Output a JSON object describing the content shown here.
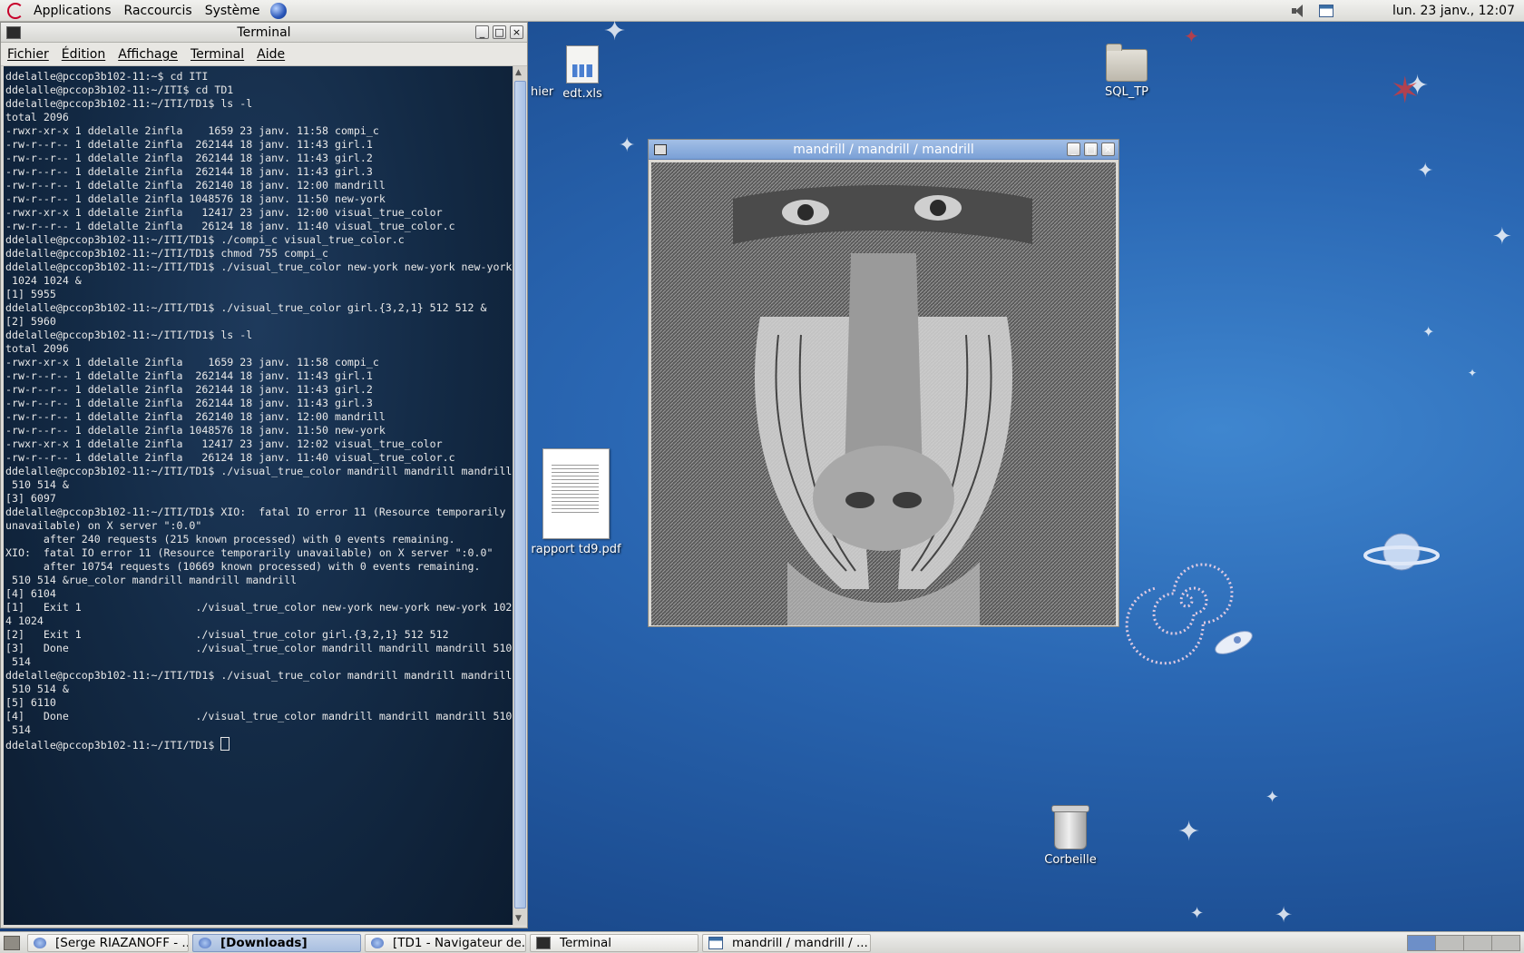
{
  "top_panel": {
    "menus": [
      "Applications",
      "Raccourcis",
      "Système"
    ],
    "clock": "lun. 23 janv., 12:07",
    "tray_icons": [
      "volume-icon",
      "window-list-icon"
    ]
  },
  "terminal": {
    "title": "Terminal",
    "menu": [
      "Fichier",
      "Édition",
      "Affichage",
      "Terminal",
      "Aide"
    ],
    "lines": [
      "ddelalle@pccop3b102-11:~$ cd ITI",
      "ddelalle@pccop3b102-11:~/ITI$ cd TD1",
      "ddelalle@pccop3b102-11:~/ITI/TD1$ ls -l",
      "total 2096",
      "-rwxr-xr-x 1 ddelalle 2infla    1659 23 janv. 11:58 compi_c",
      "-rw-r--r-- 1 ddelalle 2infla  262144 18 janv. 11:43 girl.1",
      "-rw-r--r-- 1 ddelalle 2infla  262144 18 janv. 11:43 girl.2",
      "-rw-r--r-- 1 ddelalle 2infla  262144 18 janv. 11:43 girl.3",
      "-rw-r--r-- 1 ddelalle 2infla  262140 18 janv. 12:00 mandrill",
      "-rw-r--r-- 1 ddelalle 2infla 1048576 18 janv. 11:50 new-york",
      "-rwxr-xr-x 1 ddelalle 2infla   12417 23 janv. 12:00 visual_true_color",
      "-rw-r--r-- 1 ddelalle 2infla   26124 18 janv. 11:40 visual_true_color.c",
      "ddelalle@pccop3b102-11:~/ITI/TD1$ ./compi_c visual_true_color.c",
      "ddelalle@pccop3b102-11:~/ITI/TD1$ chmod 755 compi_c",
      "ddelalle@pccop3b102-11:~/ITI/TD1$ ./visual_true_color new-york new-york new-york",
      " 1024 1024 &",
      "[1] 5955",
      "ddelalle@pccop3b102-11:~/ITI/TD1$ ./visual_true_color girl.{3,2,1} 512 512 &",
      "[2] 5960",
      "ddelalle@pccop3b102-11:~/ITI/TD1$ ls -l",
      "total 2096",
      "-rwxr-xr-x 1 ddelalle 2infla    1659 23 janv. 11:58 compi_c",
      "-rw-r--r-- 1 ddelalle 2infla  262144 18 janv. 11:43 girl.1",
      "-rw-r--r-- 1 ddelalle 2infla  262144 18 janv. 11:43 girl.2",
      "-rw-r--r-- 1 ddelalle 2infla  262144 18 janv. 11:43 girl.3",
      "-rw-r--r-- 1 ddelalle 2infla  262140 18 janv. 12:00 mandrill",
      "-rw-r--r-- 1 ddelalle 2infla 1048576 18 janv. 11:50 new-york",
      "-rwxr-xr-x 1 ddelalle 2infla   12417 23 janv. 12:02 visual_true_color",
      "-rw-r--r-- 1 ddelalle 2infla   26124 18 janv. 11:40 visual_true_color.c",
      "ddelalle@pccop3b102-11:~/ITI/TD1$ ./visual_true_color mandrill mandrill mandrill",
      " 510 514 &",
      "[3] 6097",
      "ddelalle@pccop3b102-11:~/ITI/TD1$ XIO:  fatal IO error 11 (Resource temporarily",
      "unavailable) on X server \":0.0\"",
      "      after 240 requests (215 known processed) with 0 events remaining.",
      "XIO:  fatal IO error 11 (Resource temporarily unavailable) on X server \":0.0\"",
      "      after 10754 requests (10669 known processed) with 0 events remaining.",
      " 510 514 &rue_color mandrill mandrill mandrill",
      "[4] 6104",
      "[1]   Exit 1                  ./visual_true_color new-york new-york new-york 102",
      "4 1024",
      "[2]   Exit 1                  ./visual_true_color girl.{3,2,1} 512 512",
      "[3]   Done                    ./visual_true_color mandrill mandrill mandrill 510",
      " 514",
      "ddelalle@pccop3b102-11:~/ITI/TD1$ ./visual_true_color mandrill mandrill mandrill",
      " 510 514 &",
      "[5] 6110",
      "[4]   Done                    ./visual_true_color mandrill mandrill mandrill 510",
      " 514"
    ],
    "prompt": "ddelalle@pccop3b102-11:~/ITI/TD1$ "
  },
  "mandrill_window": {
    "title": "mandrill / mandrill / mandrill"
  },
  "desktop": {
    "icons": [
      {
        "name": "edt.xls",
        "partial_label": "hier"
      },
      {
        "name": "SQL_TP"
      },
      {
        "name": "rapport td9.pdf"
      },
      {
        "name": "Corbeille"
      }
    ]
  },
  "taskbar": {
    "tasks": [
      {
        "label": "[Serge RIAZANOFF - ...",
        "icon": "browser"
      },
      {
        "label": "[Downloads]",
        "icon": "browser",
        "active": true
      },
      {
        "label": "[TD1 - Navigateur de...",
        "icon": "browser"
      },
      {
        "label": "Terminal",
        "icon": "term"
      },
      {
        "label": "mandrill / mandrill / ...",
        "icon": "win"
      }
    ],
    "workspaces": 4,
    "current_workspace": 1
  }
}
